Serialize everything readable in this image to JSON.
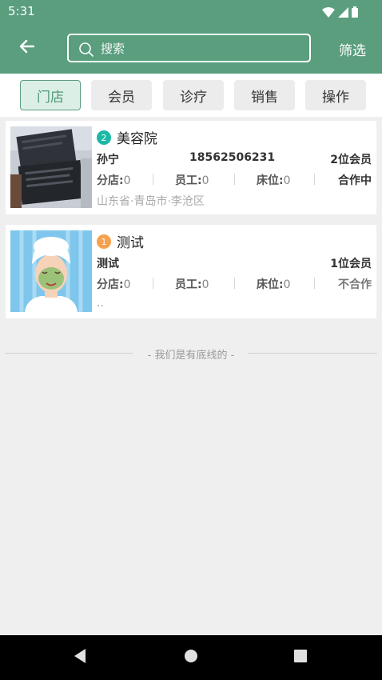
{
  "status_bar": {
    "time": "5:31",
    "icons": [
      "wifi-icon",
      "cellular-signal-icon",
      "battery-icon"
    ]
  },
  "app_bar": {
    "back_icon": "arrow-left-icon",
    "search": {
      "placeholder": "搜索",
      "value": "",
      "icon": "search-icon"
    },
    "filter_label": "筛选"
  },
  "tabs": [
    {
      "label": "门店",
      "active": true
    },
    {
      "label": "会员",
      "active": false
    },
    {
      "label": "诊疗",
      "active": false
    },
    {
      "label": "销售",
      "active": false
    },
    {
      "label": "操作",
      "active": false
    }
  ],
  "stores": [
    {
      "badge": "2",
      "name": "美容院",
      "contact": "孙宁",
      "phone": "18562506231",
      "members": "2位会员",
      "branch_label": "分店:",
      "branch_count": "0",
      "staff_label": "员工:",
      "staff_count": "0",
      "bed_label": "床位:",
      "bed_count": "0",
      "status": "合作中",
      "address": "山东省·青岛市·李沧区"
    },
    {
      "badge": "1",
      "name": "测试",
      "contact": "测试",
      "phone": "",
      "members": "1位会员",
      "branch_label": "分店:",
      "branch_count": "0",
      "staff_label": "员工:",
      "staff_count": "0",
      "bed_label": "床位:",
      "bed_count": "0",
      "status": "不合作",
      "address": ".."
    }
  ],
  "end_text": "- 我们是有底线的 -",
  "nav_bar": {
    "icons": [
      "back-triangle-icon",
      "home-circle-icon",
      "recents-square-icon"
    ]
  },
  "colors": {
    "primary": "#5a9e7e",
    "badge_teal": "#1cb8a6",
    "badge_orange": "#f5a14d",
    "background": "#efefef"
  }
}
